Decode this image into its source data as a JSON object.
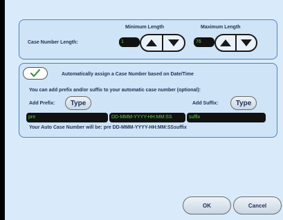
{
  "case_length": {
    "label": "Case Number Length:",
    "min_header": "Minimum Length",
    "max_header": "Maximum Length",
    "min_value": "1",
    "max_value": "76"
  },
  "auto": {
    "checkbox_label": "Automatically assign a Case Number based on Date/Time",
    "checked": true,
    "info_text": "You can add prefix and/or suffix to your automatic case number (optional):",
    "prefix_label": "Add Prefix:",
    "suffix_label": "Add Suffix:",
    "type_button": "Type",
    "prefix_value": "pre",
    "datetime_value": "DD-MMM-YYYY-HH:MM:SS",
    "suffix_value": "suffix",
    "preview_text": "Your Auto Case Number will be: pre DD-MMM-YYYY-HH:MM:SSsuffix"
  },
  "buttons": {
    "ok": "OK",
    "cancel": "Cancel"
  },
  "colors": {
    "field_text": "#5fd147",
    "panel_border": "#4a7fc7",
    "background": "#d9ebfa"
  }
}
